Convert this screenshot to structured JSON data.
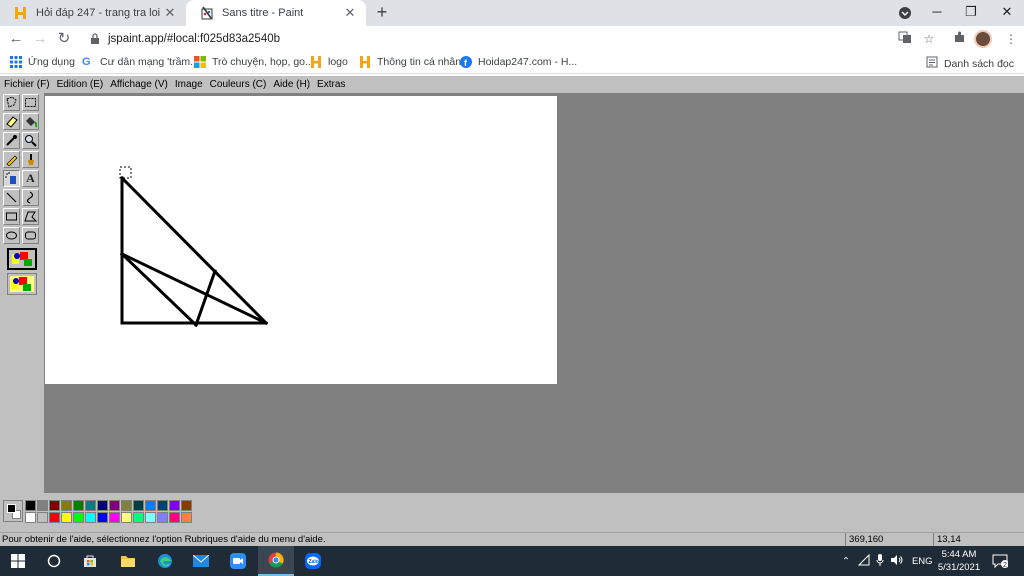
{
  "browser": {
    "tabs": [
      {
        "title": "Hỏi đáp 247 - trang tra loi",
        "active": false
      },
      {
        "title": "Sans titre - Paint",
        "active": true
      }
    ],
    "url": "jspaint.app/#local:f025d83a2540b",
    "bookmarks": [
      {
        "label": "Ứng dụng",
        "icon": "apps-grid-icon"
      },
      {
        "label": "Cư dân mạng 'trầm...",
        "icon": "google-icon"
      },
      {
        "label": "Trò chuyện, họp, go...",
        "icon": "microsoft-icon"
      },
      {
        "label": "logo",
        "icon": "hoidap-icon"
      },
      {
        "label": "Thông tin cá nhân",
        "icon": "hoidap-icon"
      },
      {
        "label": "Hoidap247.com - H...",
        "icon": "facebook-icon"
      }
    ],
    "reading_list": "Danh sách đọc"
  },
  "paint": {
    "menus": [
      "Fichier (F)",
      "Edition (E)",
      "Affichage (V)",
      "Image",
      "Couleurs (C)",
      "Aide (H)",
      "Extras"
    ],
    "tools": [
      "free-form-select-icon",
      "rect-select-icon",
      "eraser-icon",
      "fill-bucket-icon",
      "pick-color-icon",
      "magnifier-icon",
      "pencil-icon",
      "brush-icon",
      "airbrush-icon",
      "text-icon",
      "line-icon",
      "curve-icon",
      "rectangle-icon",
      "polygon-icon",
      "ellipse-icon",
      "rounded-rect-icon"
    ],
    "palette_top": [
      "#000000",
      "#808080",
      "#800000",
      "#808000",
      "#008000",
      "#008080",
      "#000080",
      "#800080",
      "#808040",
      "#004040",
      "#0080ff",
      "#004080",
      "#8000ff",
      "#804000"
    ],
    "palette_bottom": [
      "#ffffff",
      "#c0c0c0",
      "#ff0000",
      "#ffff00",
      "#00ff00",
      "#00ffff",
      "#0000ff",
      "#ff00ff",
      "#ffff80",
      "#00ff80",
      "#80ffff",
      "#8080ff",
      "#ff0080",
      "#ff8040"
    ],
    "status": {
      "help": "Pour obtenir de l'aide, sélectionnez l'option Rubriques d'aide du menu d'aide.",
      "position": "369,160",
      "selection_size": "13,14"
    }
  },
  "taskbar": {
    "language": "ENG",
    "time": "5:44 AM",
    "date": "5/31/2021",
    "notification_count": "2",
    "apps": [
      "windows-start-icon",
      "search-circle-icon",
      "store-icon",
      "file-explorer-icon",
      "edge-icon",
      "mail-icon",
      "zoom-icon",
      "chrome-icon",
      "zalo-icon"
    ]
  }
}
